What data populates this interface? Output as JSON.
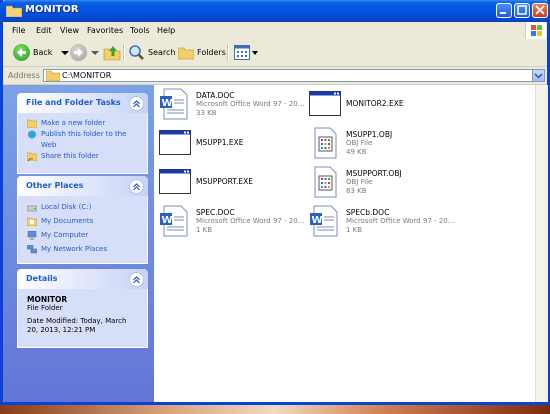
{
  "window": {
    "title": "MONITOR"
  },
  "menu": [
    "File",
    "Edit",
    "View",
    "Favorites",
    "Tools",
    "Help"
  ],
  "toolbar": {
    "back": "Back",
    "search": "Search",
    "folders": "Folders"
  },
  "address": {
    "label": "Address",
    "value": "C:\\MONITOR"
  },
  "tasks": {
    "title": "File and Folder Tasks",
    "items": [
      "Make a new folder",
      "Publish this folder to the",
      "Web",
      "Share this folder"
    ]
  },
  "places": {
    "title": "Other Places",
    "items": [
      "Local Disk (C:)",
      "My Documents",
      "My Computer",
      "My Network Places"
    ]
  },
  "details": {
    "title": "Details",
    "name": "MONITOR",
    "type": "File Folder",
    "modified_1": "Date Modified: Today, March",
    "modified_2": "20, 2013, 12:21 PM"
  },
  "files": [
    {
      "name": "DATA.DOC",
      "type": "Microsoft Office Word 97 - 20...",
      "size": "33 KB",
      "icon": "word-doc-icon"
    },
    {
      "name": "MONITOR2.EXE",
      "type": "",
      "size": "",
      "icon": "exe-window-icon"
    },
    {
      "name": "MSUPP1.EXE",
      "type": "",
      "size": "",
      "icon": "exe-window-icon"
    },
    {
      "name": "MSUPP1.OBJ",
      "type": "OBJ File",
      "size": "49 KB",
      "icon": "obj-file-icon"
    },
    {
      "name": "MSUPPORT.EXE",
      "type": "",
      "size": "",
      "icon": "exe-window-icon"
    },
    {
      "name": "MSUPPORT.OBJ",
      "type": "OBJ File",
      "size": "63 KB",
      "icon": "obj-file-icon"
    },
    {
      "name": "SPEC.DOC",
      "type": "Microsoft Office Word 97 - 20...",
      "size": "1 KB",
      "icon": "word-doc-icon"
    },
    {
      "name": "SPECb.DOC",
      "type": "Microsoft Office Word 97 - 20...",
      "size": "1 KB",
      "icon": "word-doc-icon"
    }
  ]
}
